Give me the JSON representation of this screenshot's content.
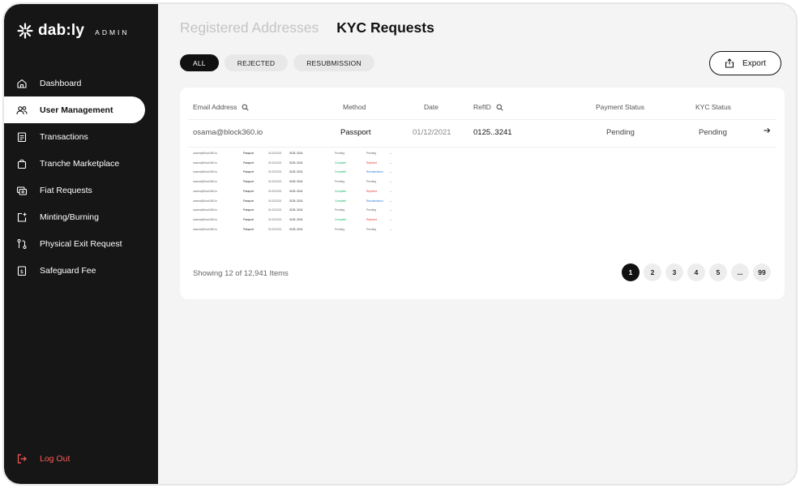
{
  "brand": {
    "name": "dab:ly",
    "tag": "ADMIN"
  },
  "sidebar": {
    "items": [
      {
        "label": "Dashboard",
        "icon": "home-icon"
      },
      {
        "label": "User Management",
        "icon": "users-icon"
      },
      {
        "label": "Transactions",
        "icon": "clipboard-icon"
      },
      {
        "label": "Tranche Marketplace",
        "icon": "bag-icon"
      },
      {
        "label": "Fiat Requests",
        "icon": "cards-icon"
      },
      {
        "label": "Minting/Burning",
        "icon": "mint-icon"
      },
      {
        "label": "Physical Exit Request",
        "icon": "route-icon"
      },
      {
        "label": "Safeguard Fee",
        "icon": "fee-icon"
      }
    ],
    "active_index": 1,
    "logout": "Log Out"
  },
  "tabs": [
    {
      "label": "Registered Addresses",
      "active": false
    },
    {
      "label": "KYC Requests",
      "active": true
    }
  ],
  "filters": [
    {
      "label": "ALL",
      "active": true
    },
    {
      "label": "REJECTED",
      "active": false
    },
    {
      "label": "RESUBMISSION",
      "active": false
    }
  ],
  "export_label": "Export",
  "table": {
    "headers": {
      "email": "Email Address",
      "method": "Method",
      "date": "Date",
      "refid": "RefID",
      "payment": "Payment Status",
      "kyc": "KYC Status"
    },
    "first_row": {
      "email": "osama@block360.io",
      "method": "Passport",
      "date": "01/12/2021",
      "refid": "0125..3241",
      "payment": "Pending",
      "kyc": "Pending"
    },
    "mini_rows": [
      {
        "email": "osama@block360.io",
        "method": "Passport",
        "date": "01/12/2021",
        "refid": "0125..3241",
        "payment": "Pending",
        "payment_color": "#666666",
        "kyc": "Pending",
        "kyc_color": "#666666"
      },
      {
        "email": "osama@block360.io",
        "method": "Passport",
        "date": "01/12/2021",
        "refid": "0125..3241",
        "payment": "Complete",
        "payment_color": "#19b36b",
        "kyc": "Rejected",
        "kyc_color": "#e0443d"
      },
      {
        "email": "osama@block360.io",
        "method": "Passport",
        "date": "01/12/2021",
        "refid": "0125..3241",
        "payment": "Complete",
        "payment_color": "#19b36b",
        "kyc": "Resubmission",
        "kyc_color": "#2f7ed8"
      },
      {
        "email": "osama@block360.io",
        "method": "Passport",
        "date": "01/12/2021",
        "refid": "0125..3241",
        "payment": "Pending",
        "payment_color": "#666666",
        "kyc": "Pending",
        "kyc_color": "#666666"
      },
      {
        "email": "osama@block360.io",
        "method": "Passport",
        "date": "01/12/2021",
        "refid": "0125..3241",
        "payment": "Complete",
        "payment_color": "#19b36b",
        "kyc": "Rejected",
        "kyc_color": "#e0443d"
      },
      {
        "email": "osama@block360.io",
        "method": "Passport",
        "date": "01/12/2021",
        "refid": "0125..3241",
        "payment": "Complete",
        "payment_color": "#19b36b",
        "kyc": "Resubmission",
        "kyc_color": "#2f7ed8"
      },
      {
        "email": "osama@block360.io",
        "method": "Passport",
        "date": "01/12/2021",
        "refid": "0125..3241",
        "payment": "Pending",
        "payment_color": "#666666",
        "kyc": "Pending",
        "kyc_color": "#666666"
      },
      {
        "email": "osama@block360.io",
        "method": "Passport",
        "date": "01/12/2021",
        "refid": "0125..3241",
        "payment": "Complete",
        "payment_color": "#19b36b",
        "kyc": "Rejected",
        "kyc_color": "#e0443d"
      },
      {
        "email": "osama@block360.io",
        "method": "Passport",
        "date": "01/12/2021",
        "refid": "0125..3241",
        "payment": "Pending",
        "payment_color": "#666666",
        "kyc": "Pending",
        "kyc_color": "#666666"
      }
    ],
    "showing": "Showing 12 of 12,941 Items"
  },
  "pagination": {
    "pages": [
      "1",
      "2",
      "3",
      "4",
      "5",
      "...",
      "99"
    ],
    "active": "1"
  },
  "colors": {
    "accent": "#111111",
    "logout": "#ff5b57",
    "complete": "#19b36b",
    "rejected": "#e0443d",
    "resubmission": "#2f7ed8"
  }
}
